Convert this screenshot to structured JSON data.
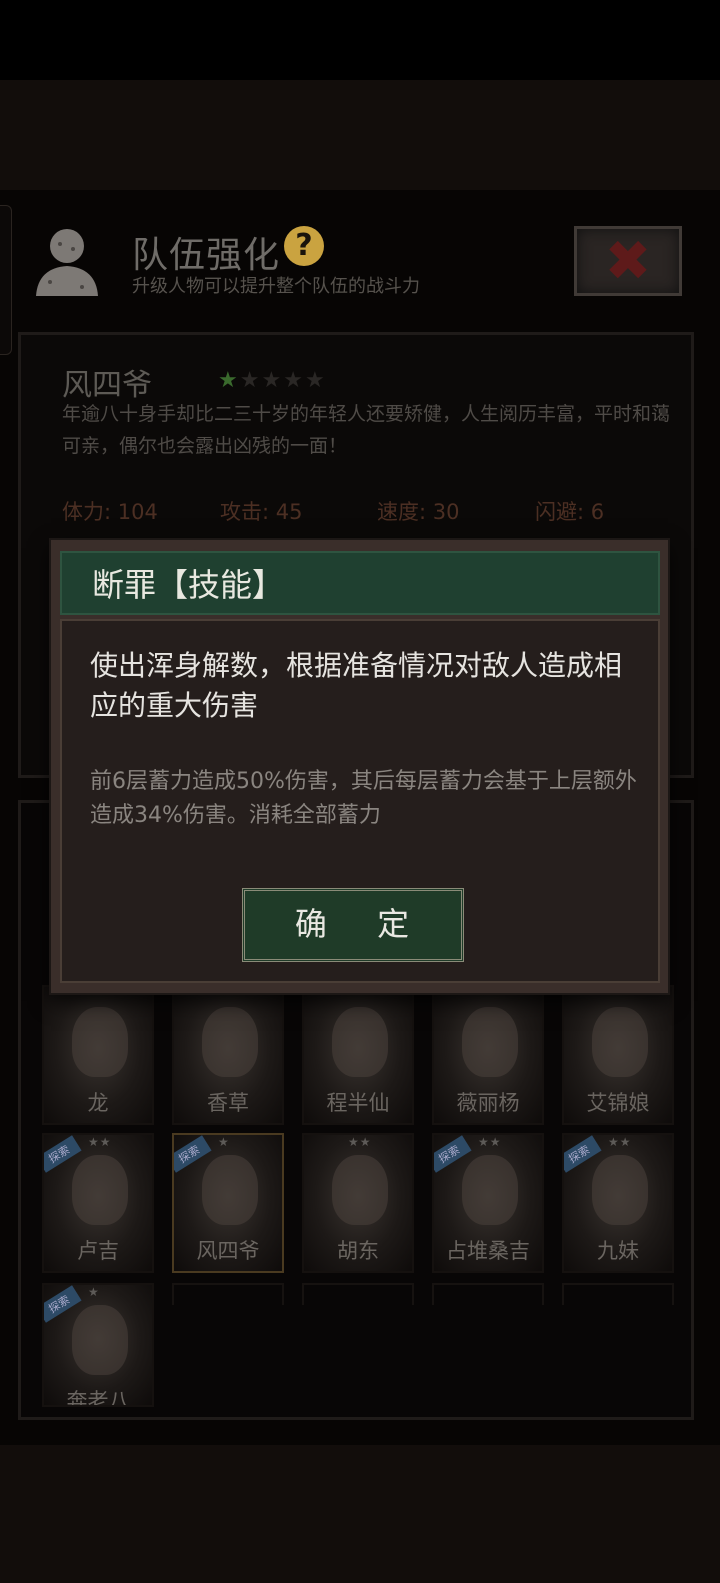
{
  "header": {
    "title": "队伍强化",
    "help_label": "?",
    "subtitle": "升级人物可以提升整个队伍的战斗力",
    "close_label": "✖"
  },
  "character": {
    "name": "风四爷",
    "stars": 1,
    "max_stars": 5,
    "description": "年逾八十身手却比二三十岁的年轻人还要矫健，人生阅历丰富，平时和蔼可亲，偶尔也会露出凶残的一面！",
    "stats": [
      {
        "text": "体力: 104"
      },
      {
        "text": "攻击: 45"
      },
      {
        "text": "速度: 30"
      },
      {
        "text": "闪避: 6"
      }
    ]
  },
  "dialog": {
    "title": "断罪【技能】",
    "description": "使出浑身解数，根据准备情况对敌人造成相应的重大伤害",
    "detail": "前6层蓄力造成50%伤害，其后每层蓄力会基于上层额外造成34%伤害。消耗全部蓄力",
    "confirm_label": "确 定"
  },
  "roster": {
    "tag_label": "探索",
    "row1": [
      {
        "name": "龙",
        "stars": "",
        "tag": false
      },
      {
        "name": "香草",
        "stars": "",
        "tag": false
      },
      {
        "name": "程半仙",
        "stars": "",
        "tag": false
      },
      {
        "name": "薇丽杨",
        "stars": "",
        "tag": false
      },
      {
        "name": "艾锦娘",
        "stars": "",
        "tag": false
      }
    ],
    "row2": [
      {
        "name": "卢吉",
        "stars": "★★",
        "tag": true
      },
      {
        "name": "风四爷",
        "stars": "★",
        "tag": true
      },
      {
        "name": "胡东",
        "stars": "★★",
        "tag": false
      },
      {
        "name": "占堆桑吉",
        "stars": "★★",
        "tag": true
      },
      {
        "name": "九妹",
        "stars": "★★",
        "tag": true
      }
    ],
    "row3": [
      {
        "name": "奔老八",
        "stars": "★",
        "tag": true
      }
    ]
  },
  "colors": {
    "dialog_header": "#1f4030",
    "confirm_button": "#1f3b28",
    "help_badge": "#caa340",
    "star_active": "#3a6a2d"
  }
}
